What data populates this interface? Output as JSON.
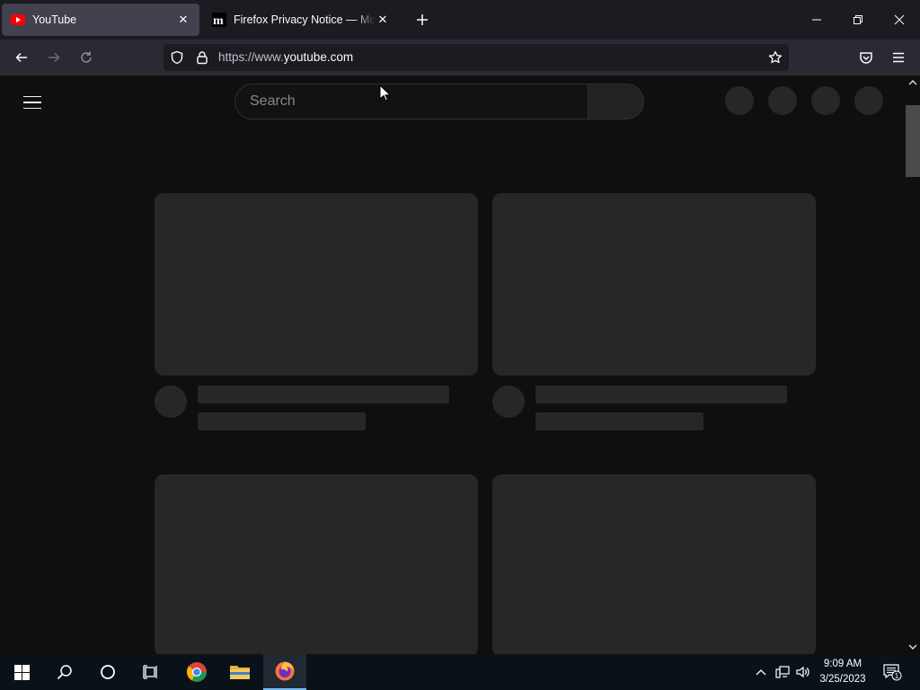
{
  "browser": {
    "tabs": [
      {
        "title": "YouTube",
        "favicon": "youtube-icon",
        "active": true
      },
      {
        "title": "Firefox Privacy Notice — Mozilla",
        "favicon": "mozilla-icon",
        "active": false
      }
    ],
    "address": {
      "prefix": "https://www.",
      "host": "youtube.com",
      "suffix": ""
    }
  },
  "youtube": {
    "search_placeholder": "Search"
  },
  "taskbar": {
    "items": [
      "windows-start",
      "search",
      "cortana",
      "task-view",
      "chrome",
      "file-explorer",
      "firefox"
    ],
    "active": "firefox",
    "time": "9:09 AM",
    "date": "3/25/2023",
    "notifications": "1"
  },
  "colors": {
    "tabstrip": "#1c1b22",
    "navbar": "#2b2a33",
    "page_bg": "#0f0f0f",
    "skeleton": "#272727",
    "taskbar": "#0a1219"
  }
}
